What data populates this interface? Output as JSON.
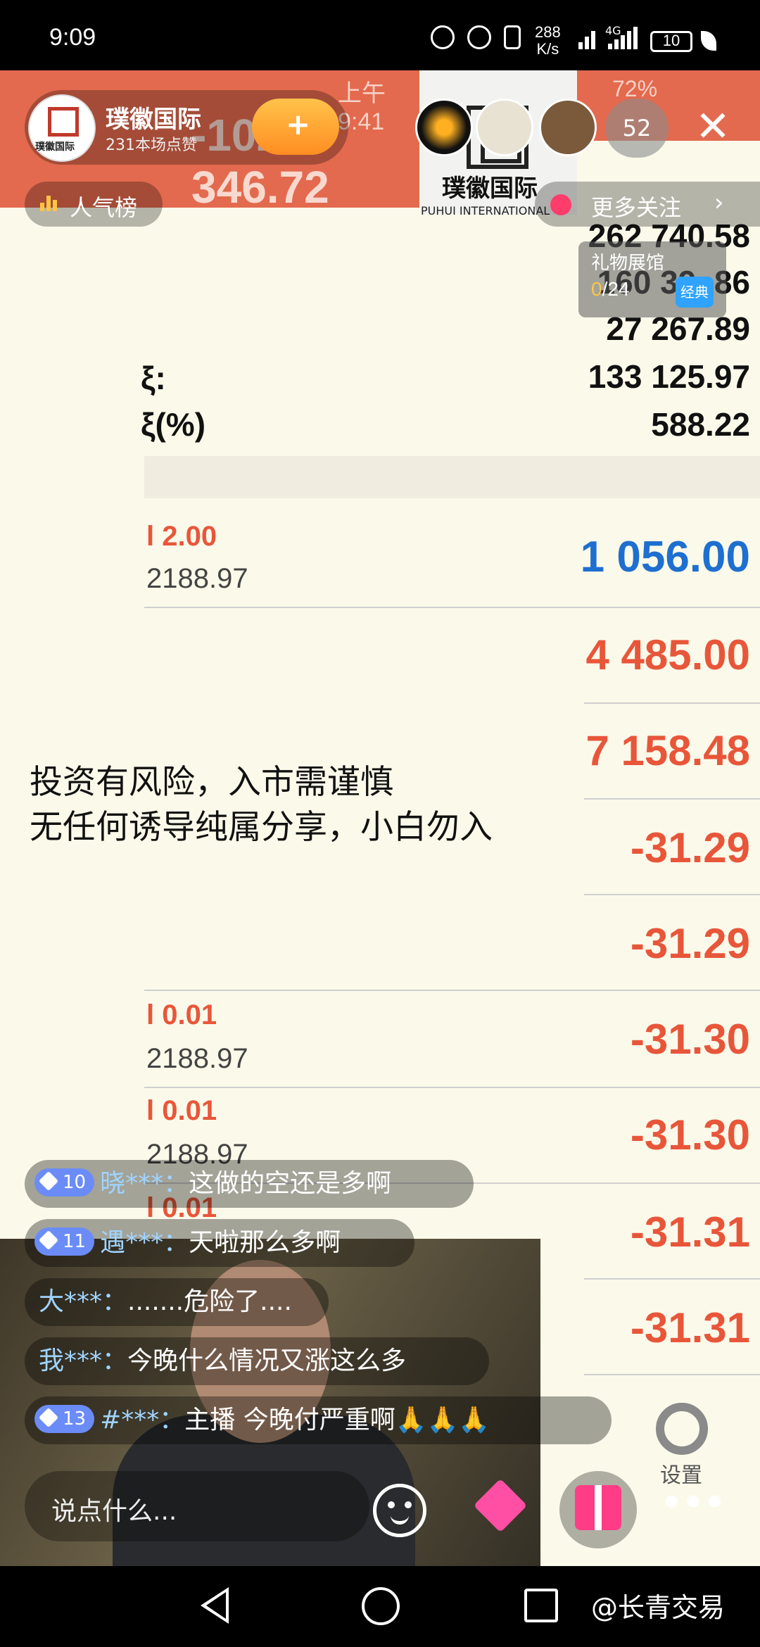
{
  "status": {
    "time": "9:09",
    "net_speed_top": "288",
    "net_speed_bottom": "K/s",
    "network_type": "4G",
    "battery": "10"
  },
  "screen_capture": {
    "phone_time": "上午 9:41",
    "phone_battery": "72%",
    "big_number": "-102 346.72",
    "logo_cn": "璞徽国际",
    "logo_en": "PUHUI INTERNATIONAL",
    "values": [
      "262 740.58",
      "160 39 .86",
      "27 267.89",
      "133 125.97",
      "588.22"
    ],
    "left_labels": [
      "ξ:",
      "ξ(%)"
    ],
    "order_rows": [
      {
        "frag_red": "l 2.00",
        "frag_gray": "2188.97",
        "value": "1 056.00",
        "color": "blue"
      },
      {
        "frag_red": "",
        "frag_gray": "",
        "value": "4 485.00",
        "color": "red"
      },
      {
        "frag_red": "",
        "frag_gray": "",
        "value": "7 158.48",
        "color": "red"
      },
      {
        "frag_red": "",
        "frag_gray": "",
        "value": "-31.29",
        "color": "red"
      },
      {
        "frag_red": "",
        "frag_gray": "",
        "value": "-31.29",
        "color": "red"
      },
      {
        "frag_red": "l 0.01",
        "frag_gray": "2188.97",
        "value": "-31.30",
        "color": "red"
      },
      {
        "frag_red": "l 0.01",
        "frag_gray": "2188.97",
        "value": "-31.30",
        "color": "red"
      },
      {
        "frag_red": "l 0.01",
        "frag_gray": "",
        "value": "-31.31",
        "color": "red"
      },
      {
        "frag_red": "",
        "frag_gray": "",
        "value": "-31.31",
        "color": "red"
      }
    ]
  },
  "host": {
    "name": "璞徽国际",
    "likes": "231本场点赞",
    "avatar_text": "璞徽国际",
    "follow_symbol": "+"
  },
  "viewers": {
    "count": "52"
  },
  "rank_label": "人气榜",
  "more_follow_label": "更多关注",
  "gift_hall": {
    "title": "礼物展馆",
    "progress_current": "0",
    "progress_total": "/24",
    "badge": "经典"
  },
  "disclaimer": {
    "line1": "投资有风险，入市需谨慎",
    "line2": "无任何诱导纯属分享，小白勿入"
  },
  "chat": [
    {
      "level": "10",
      "user": "晓***：",
      "text": "这做的空还是多啊",
      "level_color": "#6b8cf7"
    },
    {
      "level": "11",
      "user": "遇***：",
      "text": "天啦那么多啊",
      "level_color": "#6b8cf7"
    },
    {
      "level": "",
      "user": "大***：",
      "text": ".......危险了....",
      "level_color": ""
    },
    {
      "level": "",
      "user": "我***：",
      "text": "今晚什么情况又涨这么多",
      "level_color": ""
    },
    {
      "level": "13",
      "user": "#***：",
      "text": "主播 今晚付严重啊🙏🙏🙏",
      "level_color": "#6b8cf7"
    }
  ],
  "input_placeholder": "说点什么...",
  "settings_label": "设置",
  "more_dots": "•••",
  "watermark": "@长青交易"
}
